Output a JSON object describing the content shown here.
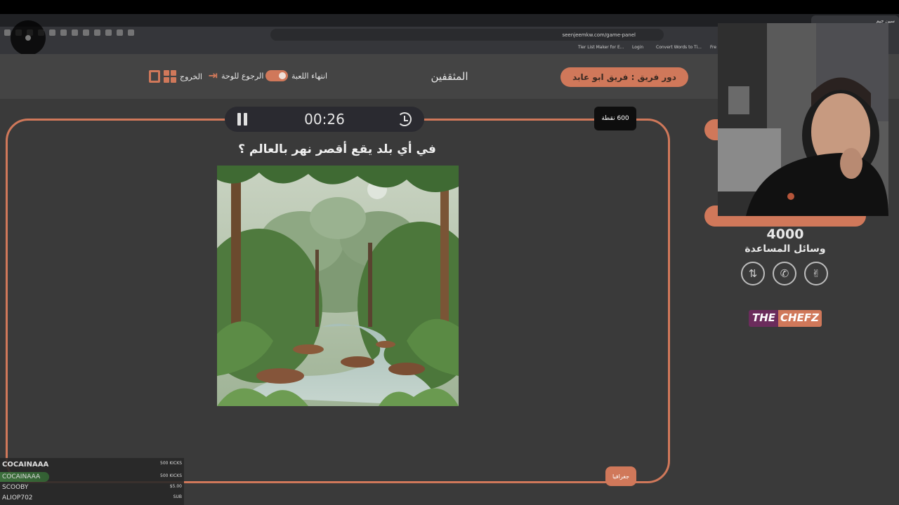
{
  "browser": {
    "tab_title": "سين جيم",
    "url": "seenjeemkw.com/game-panel",
    "bookmarks": [
      "Tier List Maker for E...",
      "Login",
      "Convert Words to Ti...",
      "Fre"
    ]
  },
  "header": {
    "team_turn": "دور فريق : فريق ابو عابد",
    "category": "المثقفين",
    "end_game": "انتهاء اللعبة",
    "back_to_board": "الرجوع للوحة",
    "exit": "الخروج"
  },
  "question_panel": {
    "timer": "00:26",
    "points": "600 نقطة",
    "question": "في أي بلد يقع أقصر نهر بالعالم ؟",
    "category_badge": "جغرافيا",
    "image": "jungle-river-illustration"
  },
  "sidebar": {
    "score": "4000",
    "aids_title": "وسائل المساعدة",
    "aids": [
      "two-answers-icon",
      "phone-icon",
      "two-fingers-icon"
    ],
    "logo_part1": "THE",
    "logo_part2": "CHEFZ"
  },
  "ticker": {
    "header_name": "COCAINAAA",
    "header_amount": "500 KICKS",
    "rows": [
      {
        "name": "COCAINAAA",
        "amount": "500 KICKS"
      },
      {
        "name": "SCOOBY",
        "amount": "$5.00"
      },
      {
        "name": "ALIOP702",
        "amount": "SUB"
      }
    ]
  },
  "colors": {
    "accent": "#d0785a",
    "background": "#3a3a3a",
    "header": "#444444"
  }
}
